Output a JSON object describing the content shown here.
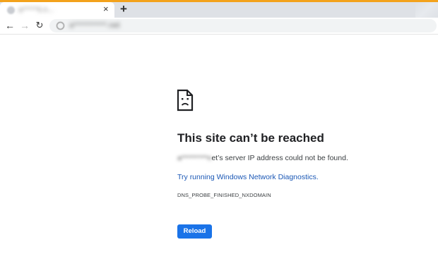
{
  "browser": {
    "accent_color": "#f3a21c",
    "tab": {
      "title": "a*****ii.n...",
      "close_label": "×",
      "favicon": "globe-icon"
    },
    "new_tab_label": "+",
    "nav": {
      "back_label": "←",
      "forward_label": "→",
      "reload_label": "↻"
    },
    "omnibox": {
      "url": "a***********.net",
      "site_info_icon": "site-info-icon"
    }
  },
  "error_page": {
    "icon": "sad-document-icon",
    "heading": "This site can’t be reached",
    "host_redacted": "a*********n",
    "host_suffix": "et’s server IP address could not be found.",
    "diagnostics_link": "Try running Windows Network Diagnostics.",
    "error_code": "DNS_PROBE_FINISHED_NXDOMAIN",
    "reload_label": "Reload",
    "link_color": "#1a57b5",
    "button_color": "#1a73e8"
  }
}
